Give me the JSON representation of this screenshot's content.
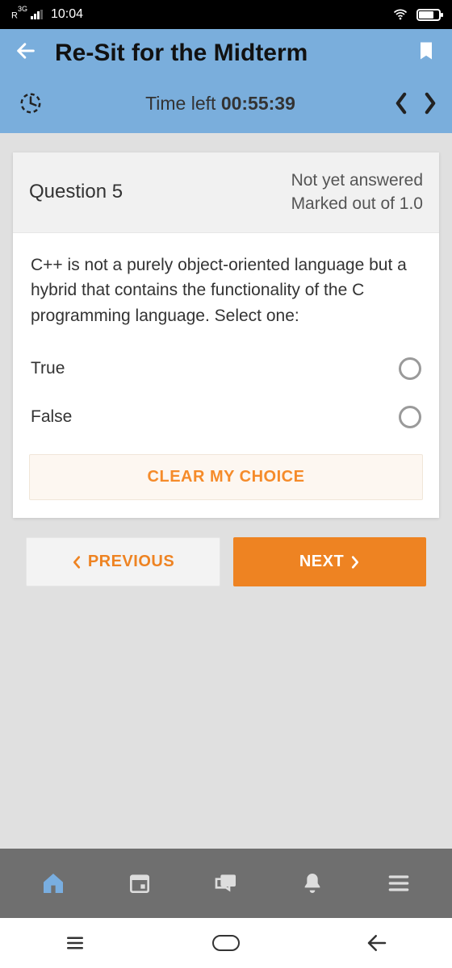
{
  "os": {
    "network_label": "3G",
    "network_prefix": "R",
    "time": "10:04"
  },
  "header": {
    "title": "Re-Sit for the Midterm"
  },
  "timer": {
    "label": "Time left ",
    "value": "00:55:39"
  },
  "question": {
    "number_label": "Question 5",
    "status_line1": "Not yet answered",
    "status_line2": "Marked out of 1.0",
    "text": "C++ is not a purely object-oriented language but a hybrid that contains the functionality of the C programming language. Select one:",
    "options": [
      "True",
      "False"
    ],
    "clear_label": "CLEAR MY CHOICE"
  },
  "nav": {
    "previous": "PREVIOUS",
    "next": "NEXT"
  }
}
